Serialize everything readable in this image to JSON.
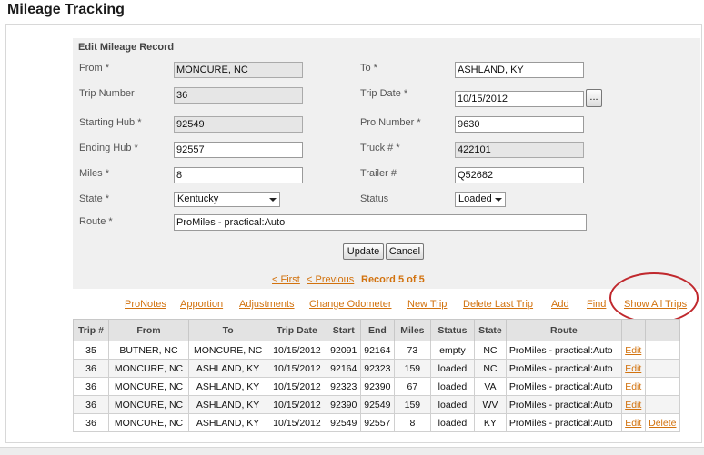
{
  "page_title": "Mileage Tracking",
  "form": {
    "header": "Edit Mileage Record",
    "from_label": "From *",
    "from_value": "MONCURE, NC",
    "to_label": "To *",
    "to_value": "ASHLAND, KY",
    "trip_number_label": "Trip Number",
    "trip_number_value": "36",
    "trip_date_label": "Trip Date *",
    "trip_date_value": "10/15/2012",
    "date_button_label": "...",
    "starting_hub_label": "Starting Hub *",
    "starting_hub_value": "92549",
    "pro_number_label": "Pro Number *",
    "pro_number_value": "9630",
    "ending_hub_label": "Ending Hub *",
    "ending_hub_value": "92557",
    "truck_label": "Truck # *",
    "truck_value": "422101",
    "miles_label": "Miles *",
    "miles_value": "8",
    "trailer_label": "Trailer #",
    "trailer_value": "Q52682",
    "state_label": "State *",
    "state_value": "Kentucky",
    "status_label": "Status",
    "status_value": "Loaded",
    "route_label": "Route *",
    "route_value": "ProMiles - practical:Auto",
    "update_label": "Update",
    "cancel_label": "Cancel"
  },
  "pager": {
    "first": "< First",
    "previous": "< Previous",
    "record_info": "Record 5 of 5"
  },
  "nav_links": {
    "pronotes": "ProNotes",
    "apportion": "Apportion",
    "adjustments": "Adjustments",
    "change_odometer": "Change Odometer",
    "new_trip": "New Trip",
    "delete_last_trip": "Delete Last Trip",
    "add": "Add",
    "find": "Find",
    "show_all_trips": "Show All Trips"
  },
  "table": {
    "headers": [
      "Trip #",
      "From",
      "To",
      "Trip Date",
      "Start",
      "End",
      "Miles",
      "Status",
      "State",
      "Route",
      "",
      ""
    ],
    "rows": [
      {
        "trip": "35",
        "from": "BUTNER, NC",
        "to": "MONCURE, NC",
        "date": "10/15/2012",
        "start": "92091",
        "end": "92164",
        "miles": "73",
        "status": "empty",
        "state": "NC",
        "route": "ProMiles - practical:Auto",
        "edit": "Edit",
        "delete": ""
      },
      {
        "trip": "36",
        "from": "MONCURE, NC",
        "to": "ASHLAND, KY",
        "date": "10/15/2012",
        "start": "92164",
        "end": "92323",
        "miles": "159",
        "status": "loaded",
        "state": "NC",
        "route": "ProMiles - practical:Auto",
        "edit": "Edit",
        "delete": ""
      },
      {
        "trip": "36",
        "from": "MONCURE, NC",
        "to": "ASHLAND, KY",
        "date": "10/15/2012",
        "start": "92323",
        "end": "92390",
        "miles": "67",
        "status": "loaded",
        "state": "VA",
        "route": "ProMiles - practical:Auto",
        "edit": "Edit",
        "delete": ""
      },
      {
        "trip": "36",
        "from": "MONCURE, NC",
        "to": "ASHLAND, KY",
        "date": "10/15/2012",
        "start": "92390",
        "end": "92549",
        "miles": "159",
        "status": "loaded",
        "state": "WV",
        "route": "ProMiles - practical:Auto",
        "edit": "Edit",
        "delete": ""
      },
      {
        "trip": "36",
        "from": "MONCURE, NC",
        "to": "ASHLAND, KY",
        "date": "10/15/2012",
        "start": "92549",
        "end": "92557",
        "miles": "8",
        "status": "loaded",
        "state": "KY",
        "route": "ProMiles - practical:Auto",
        "edit": "Edit",
        "delete": "Delete"
      }
    ]
  },
  "colors": {
    "link": "#d2720e",
    "highlight_ring": "#c0282d",
    "form_background": "#f0f0f0"
  }
}
